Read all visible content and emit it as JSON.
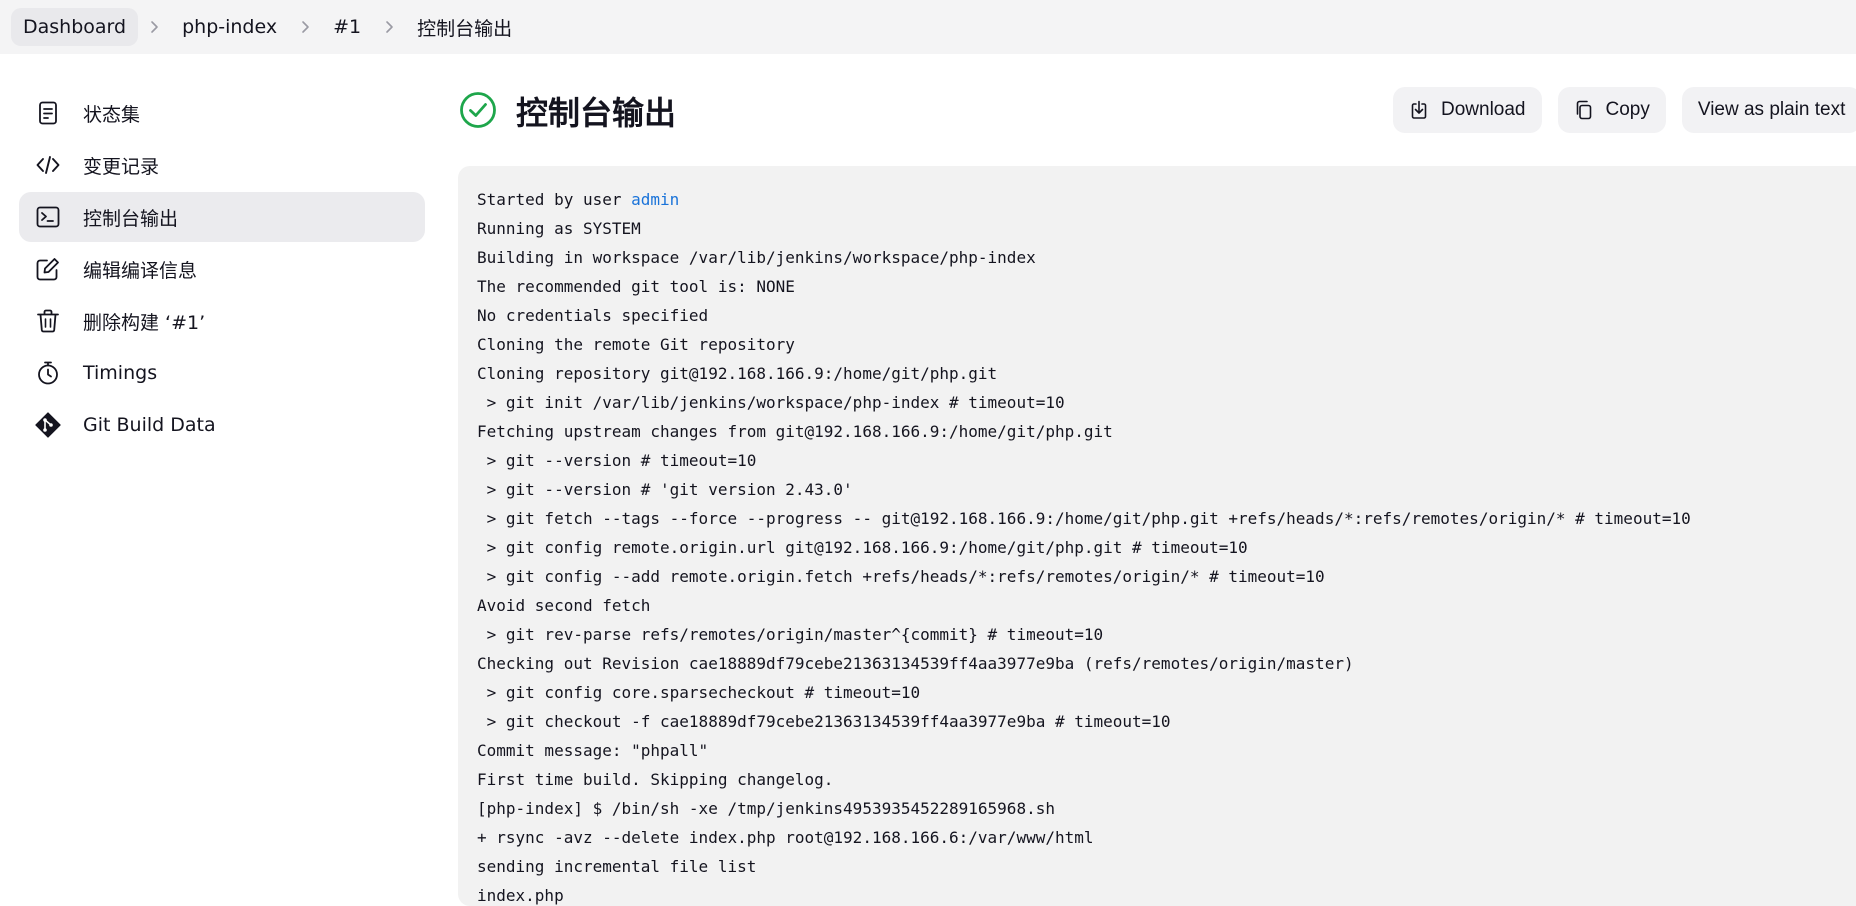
{
  "breadcrumb": {
    "items": [
      "Dashboard",
      "php-index",
      "#1",
      "控制台输出"
    ]
  },
  "sidebar": {
    "items": [
      {
        "label": "状态集",
        "icon": "document-icon"
      },
      {
        "label": "变更记录",
        "icon": "code-icon"
      },
      {
        "label": "控制台输出",
        "icon": "terminal-icon"
      },
      {
        "label": "编辑编译信息",
        "icon": "edit-icon"
      },
      {
        "label": "删除构建 ‘#1’",
        "icon": "trash-icon"
      },
      {
        "label": "Timings",
        "icon": "stopwatch-icon"
      },
      {
        "label": "Git Build Data",
        "icon": "git-icon"
      }
    ],
    "active_index": 2
  },
  "header": {
    "title": "控制台输出",
    "status": "success",
    "status_color": "#1ea64b"
  },
  "actions": {
    "download": "Download",
    "copy": "Copy",
    "plain_text": "View as plain text"
  },
  "console": {
    "started_prefix": "Started by user ",
    "started_user": "admin",
    "lines": [
      "Running as SYSTEM",
      "Building in workspace /var/lib/jenkins/workspace/php-index",
      "The recommended git tool is: NONE",
      "No credentials specified",
      "Cloning the remote Git repository",
      "Cloning repository git@192.168.166.9:/home/git/php.git",
      " > git init /var/lib/jenkins/workspace/php-index # timeout=10",
      "Fetching upstream changes from git@192.168.166.9:/home/git/php.git",
      " > git --version # timeout=10",
      " > git --version # 'git version 2.43.0'",
      " > git fetch --tags --force --progress -- git@192.168.166.9:/home/git/php.git +refs/heads/*:refs/remotes/origin/* # timeout=10",
      " > git config remote.origin.url git@192.168.166.9:/home/git/php.git # timeout=10",
      " > git config --add remote.origin.fetch +refs/heads/*:refs/remotes/origin/* # timeout=10",
      "Avoid second fetch",
      " > git rev-parse refs/remotes/origin/master^{commit} # timeout=10",
      "Checking out Revision cae18889df79cebe21363134539ff4aa3977e9ba (refs/remotes/origin/master)",
      " > git config core.sparsecheckout # timeout=10",
      " > git checkout -f cae18889df79cebe21363134539ff4aa3977e9ba # timeout=10",
      "Commit message: \"phpall\"",
      "First time build. Skipping changelog.",
      "[php-index] $ /bin/sh -xe /tmp/jenkins4953935452289165968.sh",
      "+ rsync -avz --delete index.php root@192.168.166.6:/var/www/html",
      "sending incremental file list",
      "index.php"
    ]
  }
}
